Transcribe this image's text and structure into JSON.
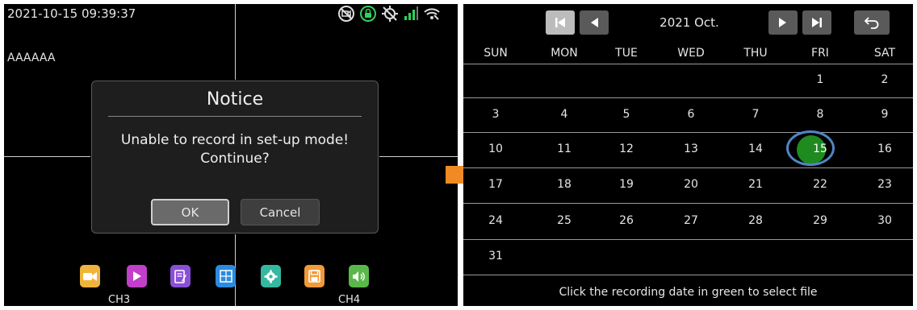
{
  "left": {
    "datetime": "2021-10-15 09:39:37",
    "channel_name": "AAAAAA",
    "status_icons": [
      "no-video-icon",
      "lock-icon",
      "gps-off-icon",
      "signal-bars-icon",
      "wifi-icon"
    ],
    "dialog": {
      "title": "Notice",
      "message_line1": "Unable to record in set-up mode!",
      "message_line2": "Continue?",
      "ok_label": "OK",
      "cancel_label": "Cancel"
    },
    "dock": [
      {
        "icon": "camera-icon",
        "color": "#f0b43c"
      },
      {
        "icon": "play-icon",
        "color": "#c13fc9"
      },
      {
        "icon": "notes-icon",
        "color": "#8a4fd8"
      },
      {
        "icon": "layout-icon",
        "color": "#2a8be0"
      },
      {
        "icon": "settings-icon",
        "color": "#35b8a0"
      },
      {
        "icon": "save-icon",
        "color": "#f09a3a"
      },
      {
        "icon": "volume-icon",
        "color": "#5ab84a"
      }
    ],
    "ch3_label": "CH3",
    "ch4_label": "CH4"
  },
  "calendar": {
    "title": "2021 Oct.",
    "weekdays": [
      "SUN",
      "MON",
      "TUE",
      "WED",
      "THU",
      "FRI",
      "SAT"
    ],
    "weeks": [
      [
        "",
        "",
        "",
        "",
        "",
        "1",
        "2"
      ],
      [
        "3",
        "4",
        "5",
        "6",
        "7",
        "8",
        "9"
      ],
      [
        "10",
        "11",
        "12",
        "13",
        "14",
        "15",
        "16"
      ],
      [
        "17",
        "18",
        "19",
        "20",
        "21",
        "22",
        "23"
      ],
      [
        "24",
        "25",
        "26",
        "27",
        "28",
        "29",
        "30"
      ],
      [
        "31",
        "",
        "",
        "",
        "",
        "",
        ""
      ]
    ],
    "selected_day": "15",
    "footer": "Click the recording date in green to select file",
    "nav_icons": [
      "first-page-icon",
      "prev-icon",
      "next-icon",
      "last-page-icon",
      "back-icon"
    ]
  },
  "colors": {
    "selected_green": "#1f8a1f",
    "ring_blue": "#4f86c6",
    "arrow_orange": "#f08a24"
  }
}
